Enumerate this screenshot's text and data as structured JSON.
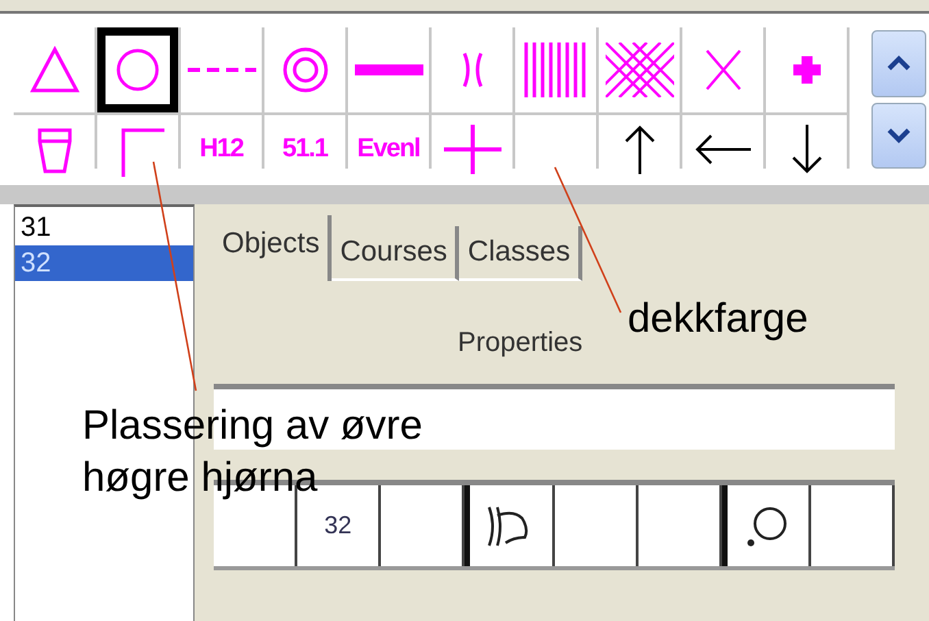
{
  "toolbar": {
    "rows": [
      [
        {
          "kind": "triangle",
          "selected": false
        },
        {
          "kind": "circle",
          "selected": true
        },
        {
          "kind": "dashed-line",
          "selected": false
        },
        {
          "kind": "double-circle",
          "selected": false
        },
        {
          "kind": "thick-line",
          "selected": false
        },
        {
          "kind": "brackets",
          "selected": false
        },
        {
          "kind": "stripes",
          "selected": false
        },
        {
          "kind": "lattice",
          "selected": false
        },
        {
          "kind": "cross",
          "selected": false
        },
        {
          "kind": "plus-bold",
          "selected": false
        }
      ],
      [
        {
          "kind": "cup",
          "selected": false
        },
        {
          "kind": "corner",
          "selected": false
        },
        {
          "kind": "text",
          "label": "H12",
          "selected": false
        },
        {
          "kind": "text",
          "label": "51.1",
          "selected": false
        },
        {
          "kind": "text",
          "label": "Evenl",
          "selected": false
        },
        {
          "kind": "plus",
          "selected": false
        },
        {
          "kind": "blank",
          "selected": false
        },
        {
          "kind": "arrow-up",
          "selected": false
        },
        {
          "kind": "arrow-left",
          "selected": false
        },
        {
          "kind": "arrow-down",
          "selected": false
        }
      ]
    ]
  },
  "list": {
    "items": [
      {
        "label": "31",
        "selected": false
      },
      {
        "label": "32",
        "selected": true
      }
    ]
  },
  "tabs": [
    {
      "label": "Objects",
      "selected": true
    },
    {
      "label": "Courses",
      "selected": false
    },
    {
      "label": "Classes",
      "selected": false
    }
  ],
  "properties": {
    "title": "Properties",
    "cells": [
      {
        "kind": "blank",
        "marked": false
      },
      {
        "kind": "text",
        "label": "32",
        "marked": false
      },
      {
        "kind": "blank",
        "marked": false
      },
      {
        "kind": "bell",
        "marked": true
      },
      {
        "kind": "blank",
        "marked": false
      },
      {
        "kind": "blank",
        "marked": false
      },
      {
        "kind": "dot-circle",
        "marked": true
      },
      {
        "kind": "blank",
        "marked": false
      }
    ]
  },
  "annotations": [
    {
      "text": "dekkfarge"
    },
    {
      "text": "Plassering av øvre høgre hjørna"
    }
  ]
}
